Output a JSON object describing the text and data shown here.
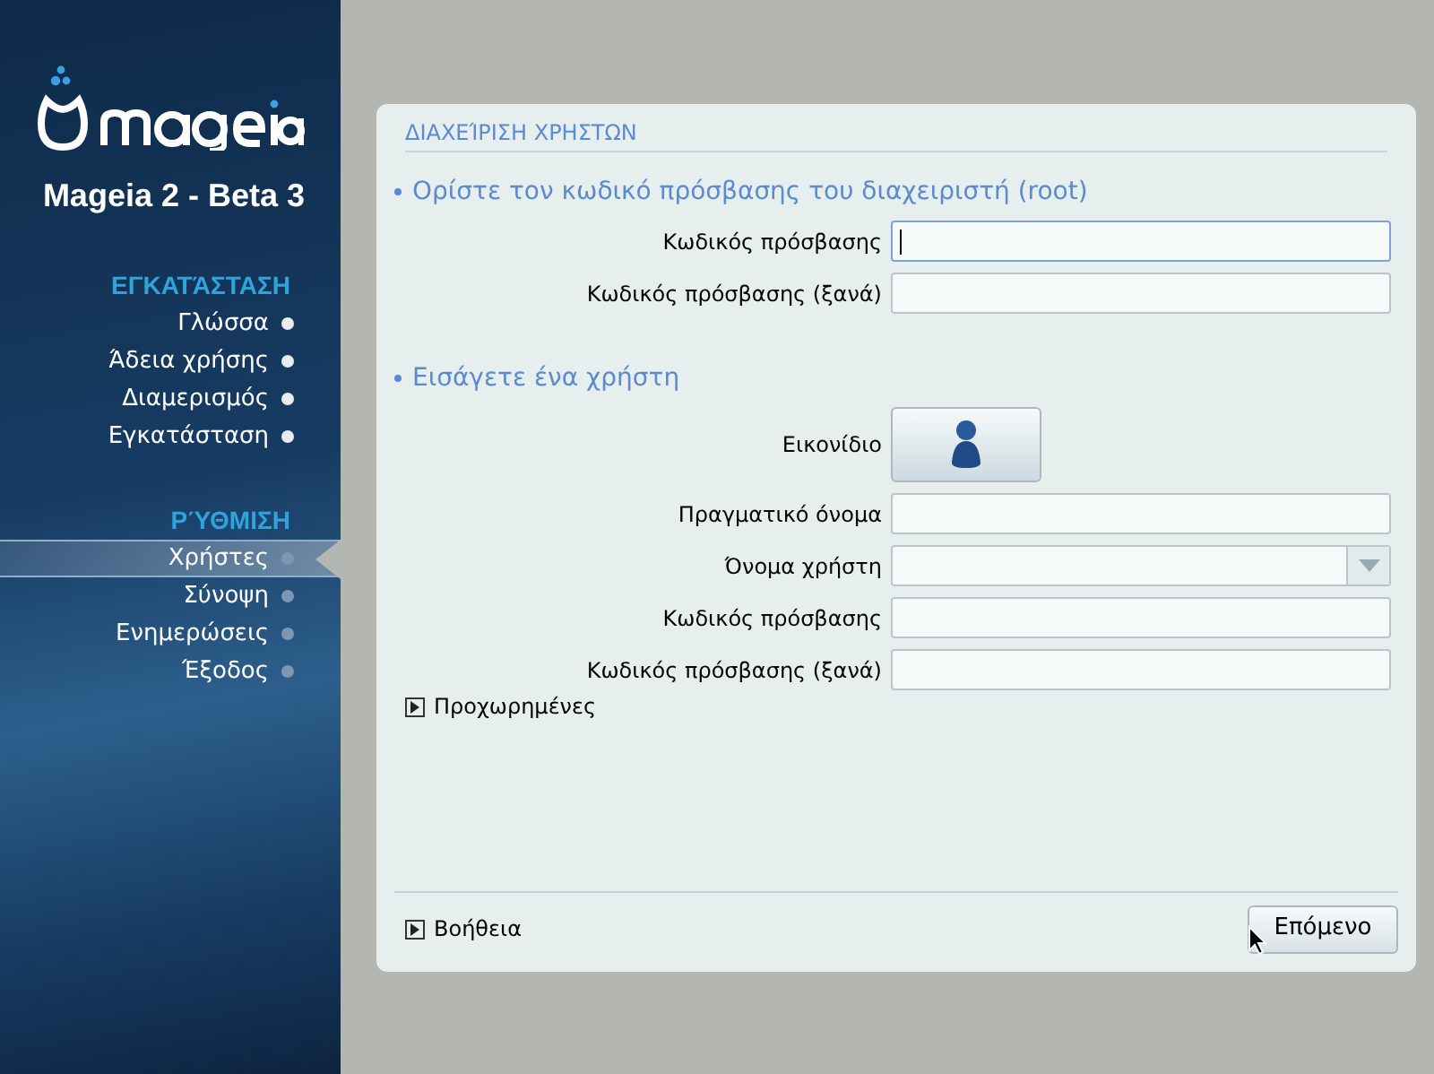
{
  "sidebar": {
    "product": "Mageia 2 - Beta 3",
    "sections": [
      {
        "title": "ΕΓΚΑΤΆΣΤΑΣΗ",
        "items": [
          {
            "label": "Γλώσσα",
            "done": true,
            "selected": false
          },
          {
            "label": "Άδεια χρήσης",
            "done": true,
            "selected": false
          },
          {
            "label": "Διαμερισμός",
            "done": true,
            "selected": false
          },
          {
            "label": "Εγκατάσταση",
            "done": true,
            "selected": false
          }
        ]
      },
      {
        "title": "ΡΎΘΜΙΣΗ",
        "items": [
          {
            "label": "Χρήστες",
            "done": false,
            "selected": true
          },
          {
            "label": "Σύνοψη",
            "done": false,
            "selected": false
          },
          {
            "label": "Ενημερώσεις",
            "done": false,
            "selected": false
          },
          {
            "label": "Έξοδος",
            "done": false,
            "selected": false
          }
        ]
      }
    ]
  },
  "panel": {
    "title": "ΔΙΑΧΕΊΡΙΣΗ ΧΡΗΣΤΩΝ",
    "groups": [
      {
        "heading": "Ορίστε τον κωδικό πρόσβασης του διαχειριστή (root)",
        "rows": [
          {
            "kind": "text",
            "label": "Κωδικός πρόσβασης",
            "focused": true
          },
          {
            "kind": "text",
            "label": "Κωδικός πρόσβασης (ξανά)",
            "focused": false
          }
        ]
      },
      {
        "heading": "Εισάγετε ένα χρήστη",
        "rows": [
          {
            "kind": "icon",
            "label": "Εικονίδιο"
          },
          {
            "kind": "text",
            "label": "Πραγματικό όνομα",
            "focused": false
          },
          {
            "kind": "combo",
            "label": "Όνομα χρήστη",
            "focused": false
          },
          {
            "kind": "text",
            "label": "Κωδικός πρόσβασης",
            "focused": false
          },
          {
            "kind": "text",
            "label": "Κωδικός πρόσβασης (ξανά)",
            "focused": false
          }
        ]
      }
    ],
    "advanced": {
      "label": "Προχωρημένες",
      "expanded": false
    },
    "help": {
      "label": "Βοήθεια",
      "expanded": false
    },
    "next_button": "Επόμενο"
  }
}
